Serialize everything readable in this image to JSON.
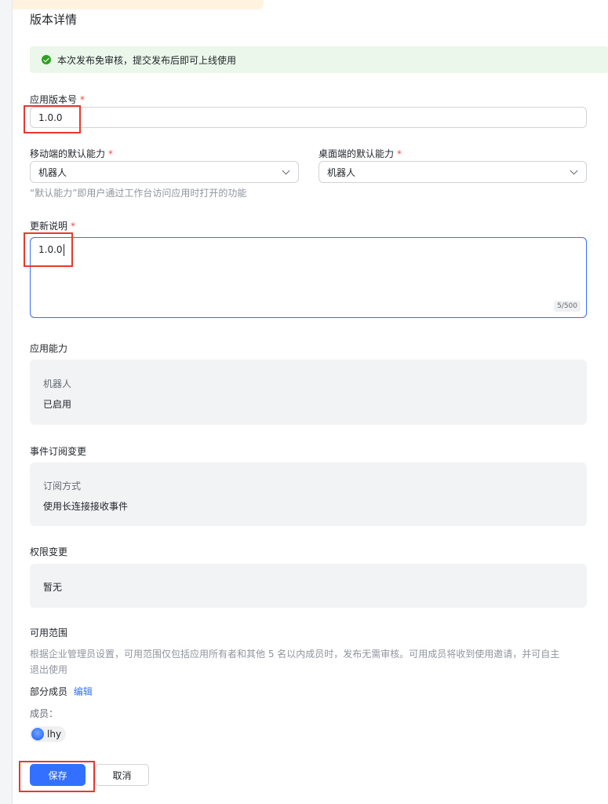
{
  "page": {
    "section_title": "版本详情",
    "notice": "本次发布免审核，提交发布后即可上线使用"
  },
  "version": {
    "label": "应用版本号",
    "required_mark": "*",
    "value": "1.0.0"
  },
  "mobile_default": {
    "label": "移动端的默认能力",
    "required_mark": "*",
    "value": "机器人"
  },
  "desktop_default": {
    "label": "桌面端的默认能力",
    "required_mark": "*",
    "value": "机器人"
  },
  "default_hint": "“默认能力”即用户通过工作台访问应用时打开的功能",
  "update_notes": {
    "label": "更新说明",
    "required_mark": "*",
    "value": "1.0.0",
    "counter": "5/500"
  },
  "capabilities": {
    "title": "应用能力",
    "name": "机器人",
    "status": "已启用"
  },
  "events": {
    "title": "事件订阅变更",
    "key": "订阅方式",
    "value": "使用长连接接收事件"
  },
  "permissions": {
    "title": "权限变更",
    "value": "暂无"
  },
  "scope": {
    "title": "可用范围",
    "desc_line1": "根据企业管理员设置，可用范围仅包括应用所有者和其他 5 名以内成员时，发布无需审核。可用成员将收到使用邀请，并可自主",
    "desc_line2": "退出使用",
    "summary": "部分成员",
    "edit_link": "编辑",
    "members_label": "成员：",
    "member_name": "lhy"
  },
  "actions": {
    "save": "保存",
    "cancel": "取消"
  },
  "colors": {
    "primary": "#3370ff",
    "success": "#2ea121",
    "required": "#f54a45",
    "highlight": "#e8382f"
  }
}
